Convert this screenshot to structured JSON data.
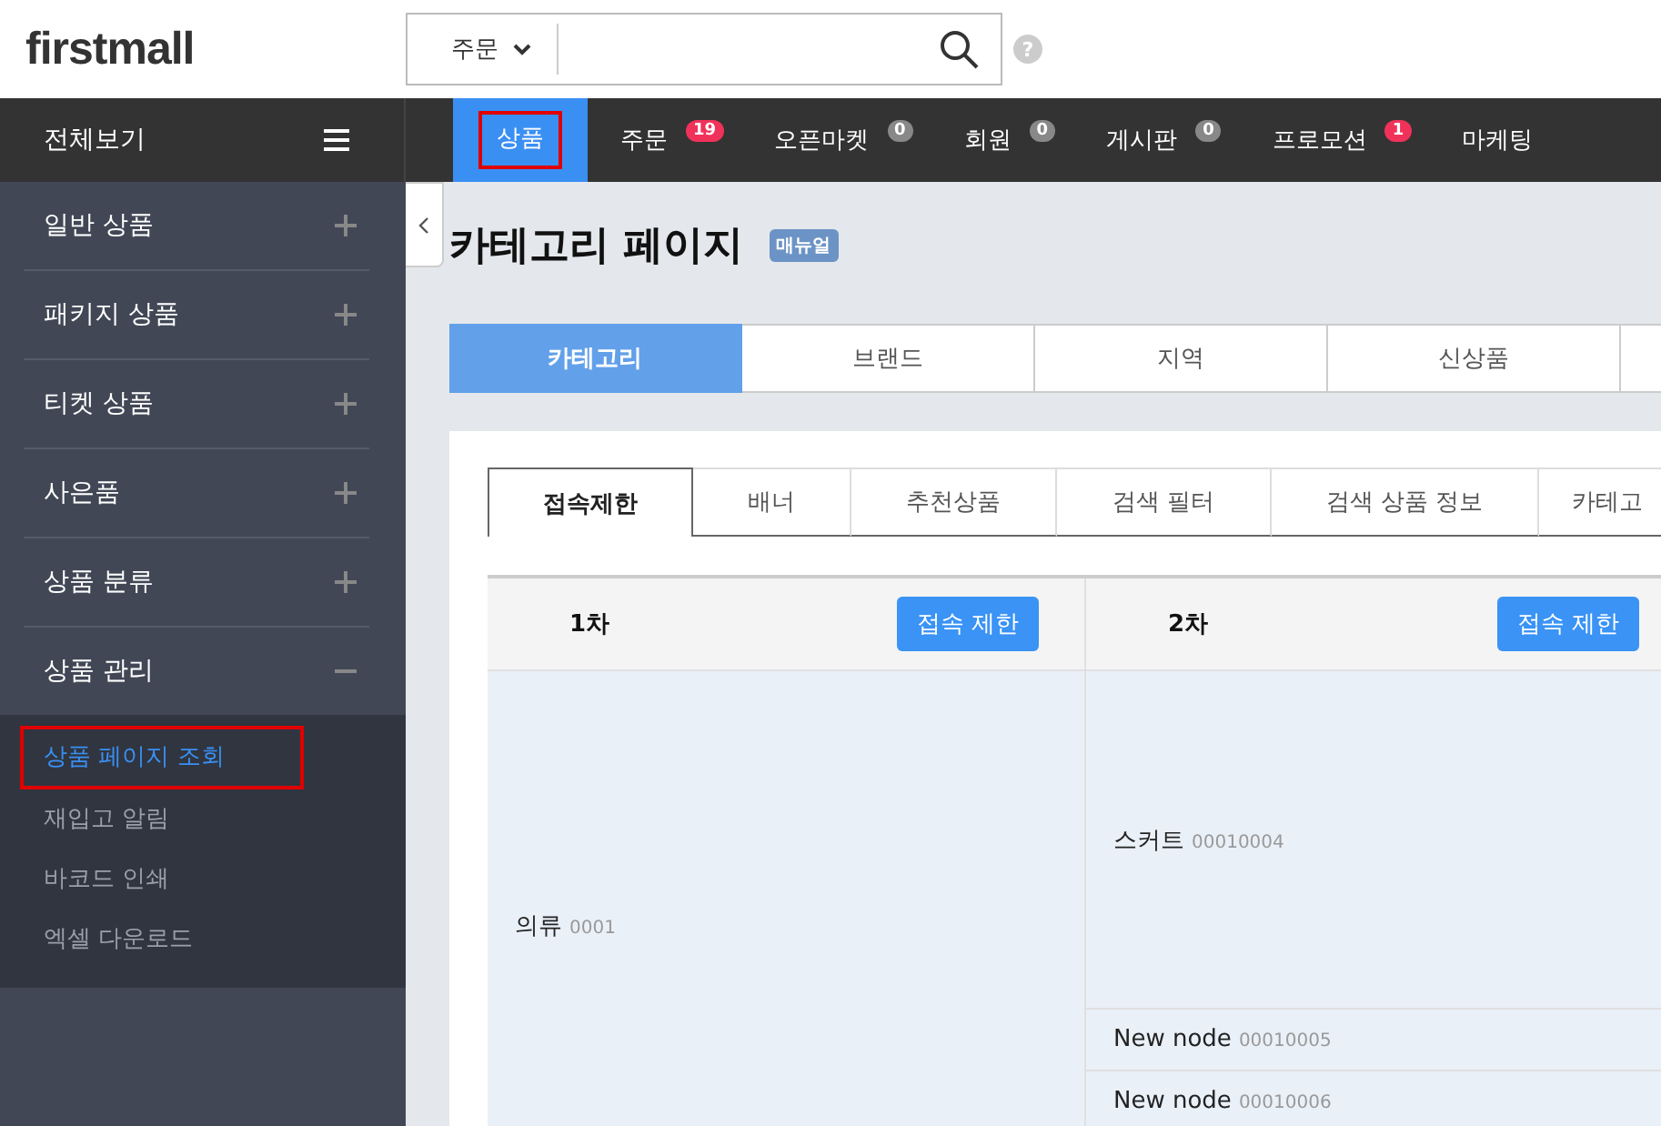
{
  "header": {
    "logo": "firstmall",
    "search": {
      "scope": "주문",
      "help": "?"
    }
  },
  "nav": {
    "all_label": "전체보기",
    "items": [
      {
        "label": "상품",
        "selected": true,
        "annotated": true
      },
      {
        "label": "주문",
        "badge": "19",
        "color": "#f0325a",
        "selected": false,
        "annotated": false
      },
      {
        "label": "오픈마켓",
        "badge": "0",
        "color": "#888888",
        "selected": false,
        "annotated": false
      },
      {
        "label": "회원",
        "badge": "0",
        "color": "#888888",
        "selected": false,
        "annotated": false
      },
      {
        "label": "게시판",
        "badge": "0",
        "color": "#888888",
        "selected": false,
        "annotated": false
      },
      {
        "label": "프로모션",
        "badge": "1",
        "color": "#f0325a",
        "selected": false,
        "annotated": false
      },
      {
        "label": "마케팅",
        "selected": false,
        "annotated": false
      }
    ]
  },
  "sidebar": {
    "items": [
      {
        "label": "일반 상품",
        "expanded": false
      },
      {
        "label": "패키지 상품",
        "expanded": false
      },
      {
        "label": "티켓 상품",
        "expanded": false
      },
      {
        "label": "사은품",
        "expanded": false
      },
      {
        "label": "상품 분류",
        "expanded": false
      },
      {
        "label": "상품 관리",
        "expanded": true,
        "children": [
          {
            "label": "상품 페이지 조회",
            "selected": true,
            "annotated": true
          },
          {
            "label": "재입고 알림",
            "selected": false,
            "annotated": false
          },
          {
            "label": "바코드 인쇄",
            "selected": false,
            "annotated": false
          },
          {
            "label": "엑셀 다운로드",
            "selected": false,
            "annotated": false
          }
        ]
      }
    ]
  },
  "page": {
    "title": "카테고리 페이지",
    "manual_badge": "매뉴얼"
  },
  "tabs": [
    {
      "label": "카테고리",
      "selected": true
    },
    {
      "label": "브랜드",
      "selected": false
    },
    {
      "label": "지역",
      "selected": false
    },
    {
      "label": "신상품",
      "selected": false
    },
    {
      "selected": false
    }
  ],
  "subtabs": [
    {
      "label": "접속제한",
      "selected": true
    },
    {
      "label": "배너",
      "selected": false
    },
    {
      "label": "추천상품",
      "selected": false
    },
    {
      "label": "검색 필터",
      "selected": false
    },
    {
      "label": "검색 상품 정보",
      "selected": false
    },
    {
      "label": "카테고",
      "selected": false
    }
  ],
  "table": {
    "columns": [
      {
        "title": "1차",
        "button": "접속 제한"
      },
      {
        "title": "2차",
        "button": "접속 제한"
      }
    ],
    "level1": {
      "name": "의류",
      "code": "0001"
    },
    "level2": [
      {
        "name": "스커트",
        "code": "00010004",
        "kind": "tall"
      },
      {
        "name": "New node",
        "code": "00010005",
        "kind": "short"
      },
      {
        "name": "New node",
        "code": "00010006",
        "kind": "short"
      }
    ]
  }
}
